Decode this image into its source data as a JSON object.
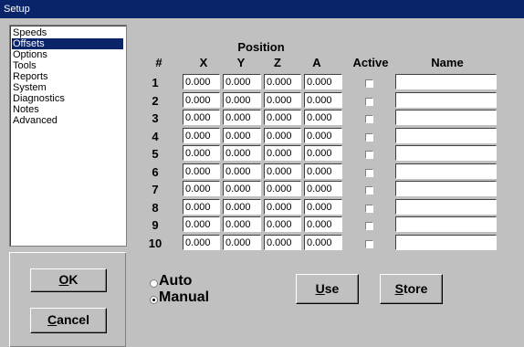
{
  "window": {
    "title": "Setup"
  },
  "menu": {
    "items": [
      "Speeds",
      "Offsets",
      "Options",
      "Tools",
      "Reports",
      "System",
      "Diagnostics",
      "Notes",
      "Advanced"
    ],
    "selected": "Offsets"
  },
  "buttons": {
    "ok": "OK",
    "cancel": "Cancel",
    "use": "Use",
    "store": "Store"
  },
  "table": {
    "group_header": "Position",
    "headers": {
      "num": "#",
      "x": "X",
      "y": "Y",
      "z": "Z",
      "a": "A",
      "active": "Active",
      "name": "Name"
    },
    "rows": [
      {
        "num": "1",
        "x": "0.000",
        "y": "0.000",
        "z": "0.000",
        "a": "0.000",
        "active": false,
        "name": ""
      },
      {
        "num": "2",
        "x": "0.000",
        "y": "0.000",
        "z": "0.000",
        "a": "0.000",
        "active": false,
        "name": ""
      },
      {
        "num": "3",
        "x": "0.000",
        "y": "0.000",
        "z": "0.000",
        "a": "0.000",
        "active": false,
        "name": ""
      },
      {
        "num": "4",
        "x": "0.000",
        "y": "0.000",
        "z": "0.000",
        "a": "0.000",
        "active": false,
        "name": ""
      },
      {
        "num": "5",
        "x": "0.000",
        "y": "0.000",
        "z": "0.000",
        "a": "0.000",
        "active": false,
        "name": ""
      },
      {
        "num": "6",
        "x": "0.000",
        "y": "0.000",
        "z": "0.000",
        "a": "0.000",
        "active": false,
        "name": ""
      },
      {
        "num": "7",
        "x": "0.000",
        "y": "0.000",
        "z": "0.000",
        "a": "0.000",
        "active": false,
        "name": ""
      },
      {
        "num": "8",
        "x": "0.000",
        "y": "0.000",
        "z": "0.000",
        "a": "0.000",
        "active": false,
        "name": ""
      },
      {
        "num": "9",
        "x": "0.000",
        "y": "0.000",
        "z": "0.000",
        "a": "0.000",
        "active": false,
        "name": ""
      },
      {
        "num": "10",
        "x": "0.000",
        "y": "0.000",
        "z": "0.000",
        "a": "0.000",
        "active": false,
        "name": ""
      }
    ]
  },
  "mode": {
    "options": [
      "Auto",
      "Manual"
    ],
    "selected": "Manual"
  },
  "colors": {
    "titlebar": "#0a246a",
    "selection": "#0a246a",
    "face": "#c0c0c0"
  }
}
